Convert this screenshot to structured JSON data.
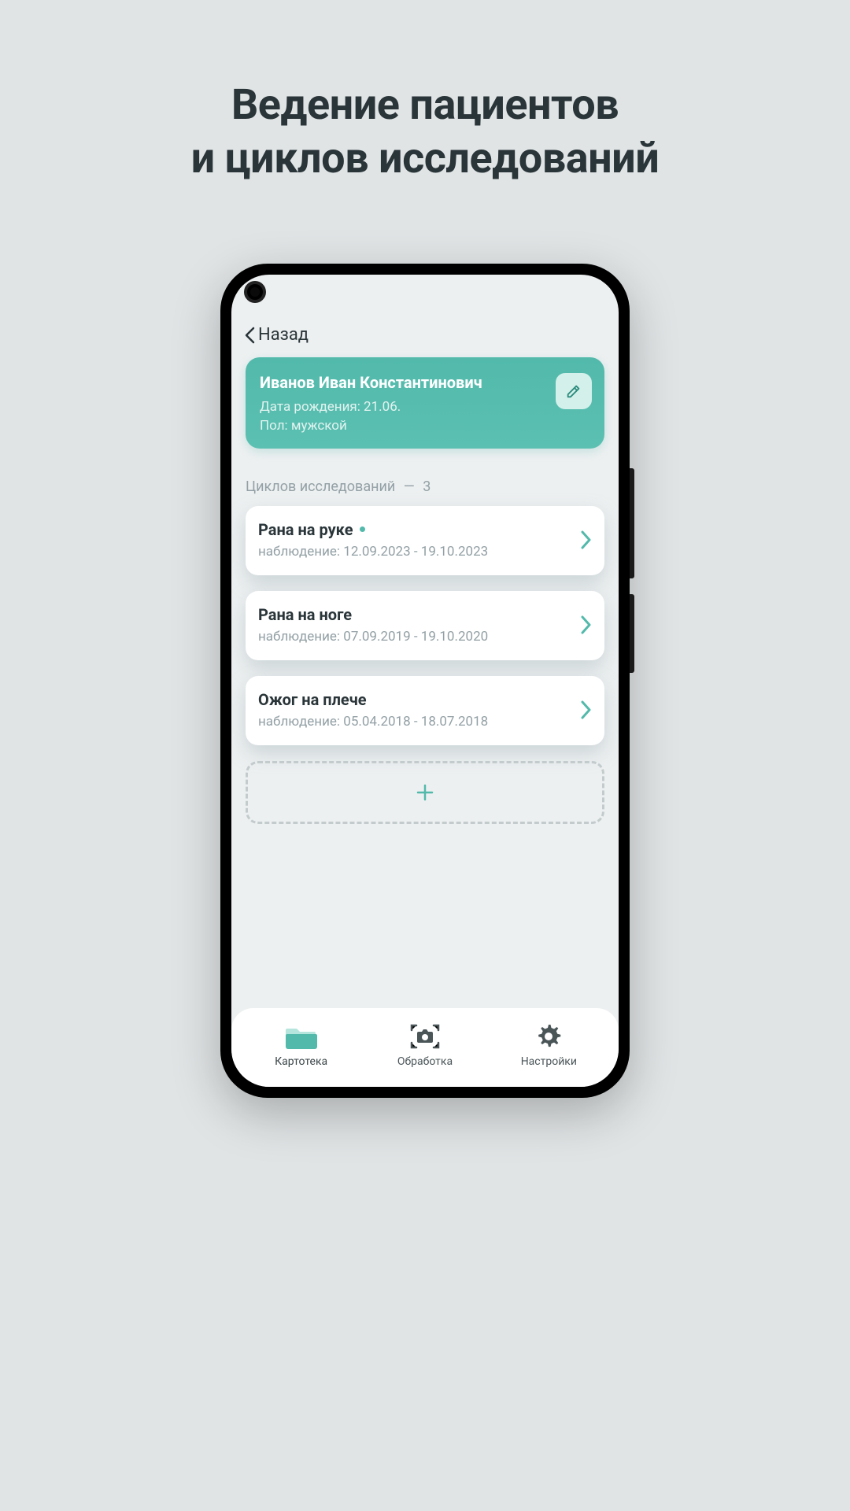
{
  "headline": "Ведение пациентов\nи циклов исследований",
  "back_label": "Назад",
  "patient": {
    "name": "Иванов Иван Константинович",
    "dob_label": "Дата рождения: 21.06.",
    "gender_label": "Пол: мужской"
  },
  "section": {
    "label": "Циклов исследований",
    "count": "3"
  },
  "cycles": [
    {
      "title": "Рана на руке",
      "active": true,
      "sub": "наблюдение: 12.09.2023 - 19.10.2023"
    },
    {
      "title": "Рана на ноге",
      "active": false,
      "sub": "наблюдение: 07.09.2019 - 19.10.2020"
    },
    {
      "title": "Ожог на плече",
      "active": false,
      "sub": "наблюдение: 05.04.2018 - 18.07.2018"
    }
  ],
  "nav": {
    "items": [
      {
        "label": "Картотека"
      },
      {
        "label": "Обработка"
      },
      {
        "label": "Настройки"
      }
    ]
  },
  "colors": {
    "accent": "#52b9ab"
  }
}
